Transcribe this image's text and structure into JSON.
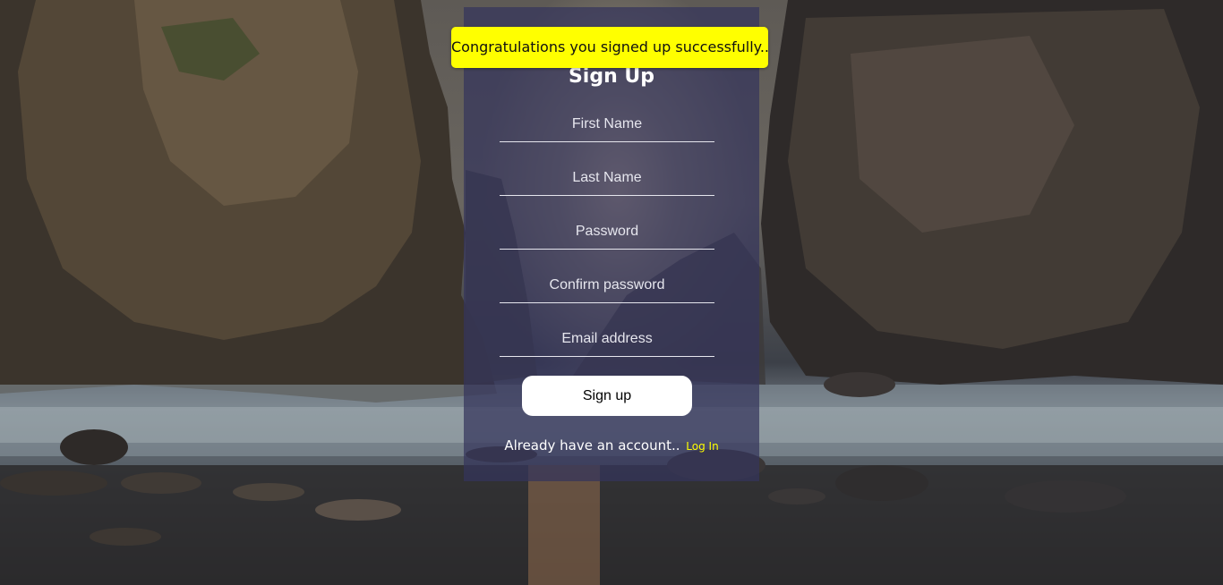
{
  "notification": {
    "message": "Congratulations you signed up successfully.."
  },
  "form": {
    "title": "Sign Up",
    "fields": [
      {
        "placeholder": "First Name",
        "type": "text"
      },
      {
        "placeholder": "Last Name",
        "type": "text"
      },
      {
        "placeholder": "Password",
        "type": "password"
      },
      {
        "placeholder": "Confirm password",
        "type": "password"
      },
      {
        "placeholder": "Email address",
        "type": "email"
      }
    ],
    "submit_label": "Sign up",
    "login_prompt": "Already have an account..",
    "login_link": "Log In"
  },
  "colors": {
    "notification_bg": "#ffff00",
    "panel_bg": "rgba(52,52,92,0.72)",
    "link": "#ffff00",
    "button_bg": "#ffffff"
  }
}
